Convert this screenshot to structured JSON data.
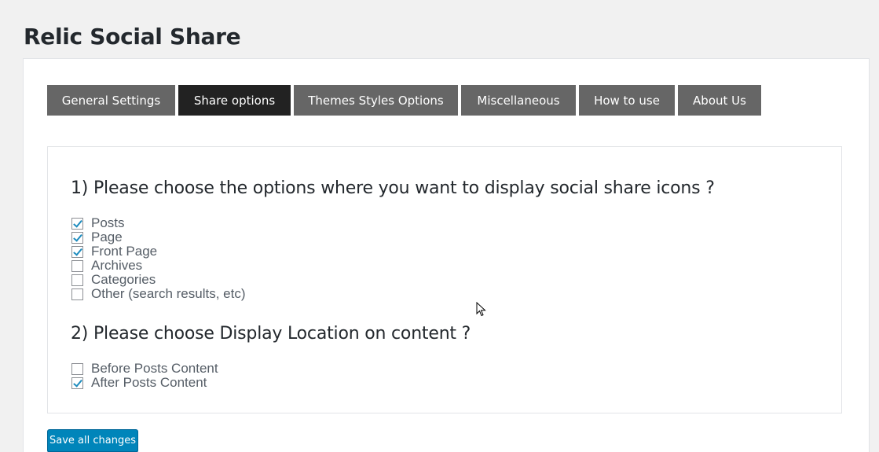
{
  "page": {
    "title": "Relic Social Share"
  },
  "tabs": [
    {
      "label": "General Settings",
      "active": false
    },
    {
      "label": "Share options",
      "active": true
    },
    {
      "label": "Themes Styles Options",
      "active": false
    },
    {
      "label": "Miscellaneous",
      "active": false
    },
    {
      "label": "How to use",
      "active": false
    },
    {
      "label": "About Us",
      "active": false
    }
  ],
  "section1": {
    "question": "1) Please choose the options where you want to display social share icons ?",
    "options": [
      {
        "label": "Posts",
        "checked": true
      },
      {
        "label": "Page",
        "checked": true
      },
      {
        "label": "Front Page",
        "checked": true
      },
      {
        "label": "Archives",
        "checked": false
      },
      {
        "label": "Categories",
        "checked": false
      },
      {
        "label": "Other (search results, etc)",
        "checked": false
      }
    ]
  },
  "section2": {
    "question": "2) Please choose Display Location on content ?",
    "options": [
      {
        "label": "Before Posts Content",
        "checked": false
      },
      {
        "label": "After Posts Content",
        "checked": true
      }
    ]
  },
  "actions": {
    "save_label": "Save all changes"
  },
  "colors": {
    "tab_inactive": "#666666",
    "tab_active": "#222222",
    "primary_button": "#0085ba",
    "checkmark": "#1e8cbe"
  }
}
